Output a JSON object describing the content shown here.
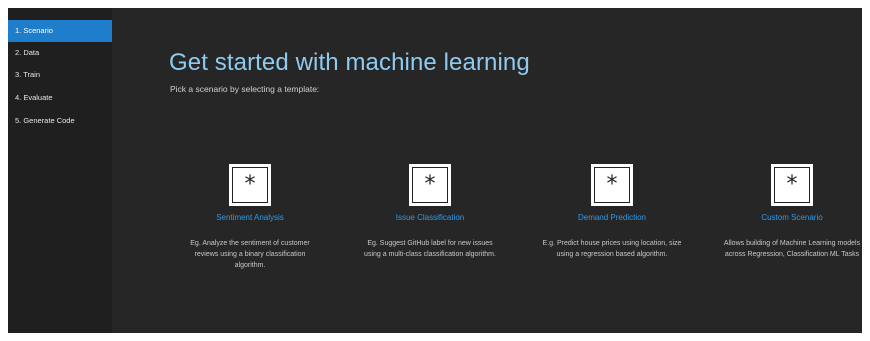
{
  "sidebar": {
    "steps": [
      {
        "label": "1.  Scenario",
        "active": true
      },
      {
        "label": "2.  Data",
        "active": false
      },
      {
        "label": "3.  Train",
        "active": false
      },
      {
        "label": "4.  Evaluate",
        "active": false
      },
      {
        "label": "5.  Generate Code",
        "active": false
      }
    ]
  },
  "main": {
    "title": "Get started with machine learning",
    "subtitle": "Pick a scenario by selecting a template:",
    "scenarios": [
      {
        "icon": "asterisk-icon",
        "icon_glyph": "*",
        "title": "Sentiment Analysis",
        "description": "Eg. Analyze the sentiment of customer reviews using a binary classification algorithm."
      },
      {
        "icon": "asterisk-icon",
        "icon_glyph": "*",
        "title": "Issue Classification",
        "description": "Eg. Suggest GitHub label for new issues using a multi-class classification algorithm."
      },
      {
        "icon": "asterisk-icon",
        "icon_glyph": "*",
        "title": "Demand Prediction",
        "description": "E.g. Predict house prices using location, size using a regression based algorithm."
      },
      {
        "icon": "asterisk-icon",
        "icon_glyph": "*",
        "title": "Custom Scenario",
        "description": "Allows building of Machine Learning models across Regression, Classification ML Tasks"
      }
    ]
  },
  "colors": {
    "background": "#262626",
    "sidebar": "#1f1f1f",
    "accent": "#1e7ecb",
    "title": "#8fcbf0",
    "link": "#2f9be8"
  }
}
